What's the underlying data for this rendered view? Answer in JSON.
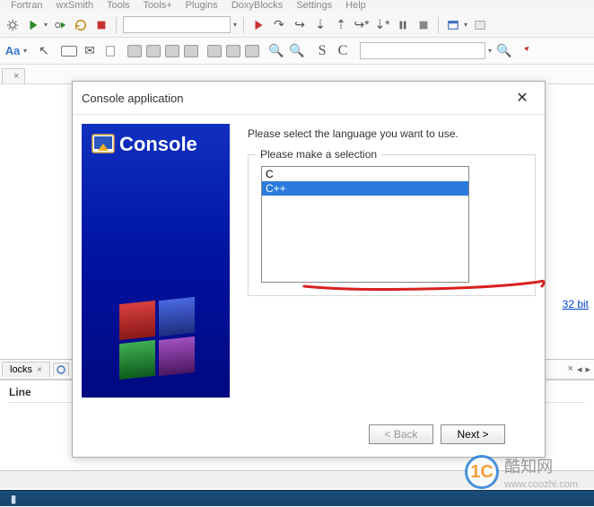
{
  "menu": [
    "Fortran",
    "wxSmith",
    "Tools",
    "Tools+",
    "Plugins",
    "DoxyBlocks",
    "Settings",
    "Help"
  ],
  "toolbar1": {
    "gear": "gear-icon",
    "play": "play-icon",
    "bug": "bug-icon"
  },
  "toolbar2": {
    "aa": "Aa",
    "s": "S",
    "c": "C"
  },
  "editor_link": "32 bit",
  "bottom_tab_label": "locks",
  "bottom_tab2_icon_hint": "circle",
  "bottom_head": "Line",
  "dialog": {
    "title": "Console application",
    "banner_title": "Console",
    "prompt": "Please select the language you want to use.",
    "group_label": "Please make a selection",
    "items": [
      "C",
      "C++"
    ],
    "selected_index": 1,
    "back": "< Back",
    "next": "Next >"
  },
  "watermark": {
    "logo": "1C",
    "text": "酷知网",
    "url": "www.coozhi.com"
  }
}
